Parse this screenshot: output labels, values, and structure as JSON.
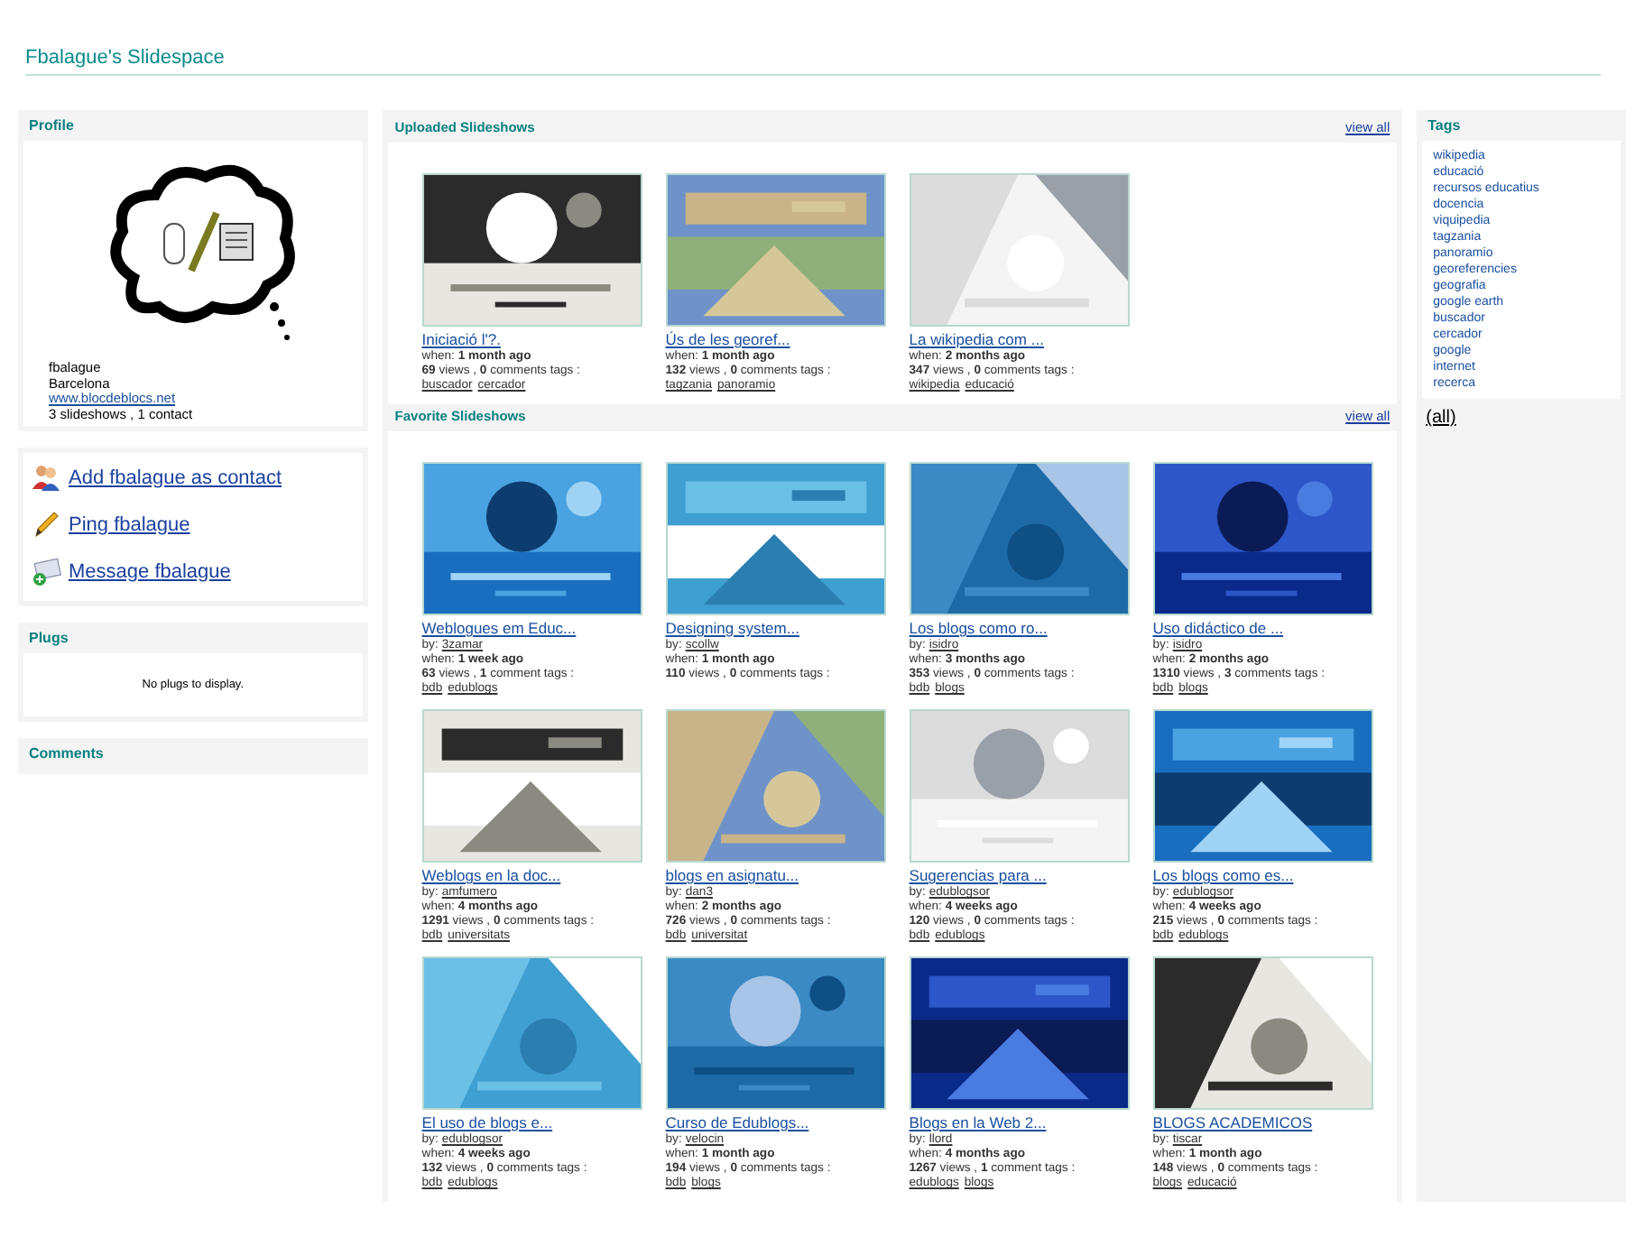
{
  "page_title": "Fbalague's Slidespace",
  "profile": {
    "title": "Profile",
    "name": "fbalague",
    "city": "Barcelona",
    "website": "www.blocdeblocs.net",
    "summary": "3 slideshows , 1 contact"
  },
  "actions": [
    {
      "kind": "contact",
      "label": "Add fbalague as contact"
    },
    {
      "kind": "ping",
      "label": "Ping fbalague"
    },
    {
      "kind": "message",
      "label": "Message fbalague"
    }
  ],
  "plugs": {
    "title": "Plugs",
    "empty": "No plugs to display."
  },
  "comments": {
    "title": "Comments"
  },
  "uploaded": {
    "title": "Uploaded Slideshows",
    "view_all": "view all",
    "items": [
      {
        "title": "Iniciació l'?.",
        "when": "when: **1 month ago**",
        "stats": "**69** views , **0** comments  tags :",
        "tags": [
          "buscador",
          "cercador"
        ]
      },
      {
        "title": "Ús de les georef...",
        "when": "when: **1 month ago**",
        "stats": "**132** views , **0** comments  tags :",
        "tags": [
          "tagzania",
          "panoramio"
        ]
      },
      {
        "title": "La wikipedia com ...",
        "when": "when: **2 months ago**",
        "stats": "**347** views , **0** comments  tags :",
        "tags": [
          "wikipedia",
          "educació"
        ]
      }
    ]
  },
  "favorites": {
    "title": "Favorite Slideshows",
    "view_all": "view all",
    "items": [
      {
        "title": "Weblogues em Educ...",
        "by_label": "by:",
        "by": "3zamar",
        "when": "when: **1 week ago**",
        "stats": "**63** views , **1** comment  tags :",
        "tags": [
          "bdb",
          "edublogs"
        ]
      },
      {
        "title": "Designing system...",
        "by_label": "by:",
        "by": "scollw",
        "when": "when: **1 month ago**",
        "stats": "**110** views , **0** comments  tags :"
      },
      {
        "title": "Los blogs como ro...",
        "by_label": "by:",
        "by": "isidro",
        "when": "when: **3 months ago**",
        "stats": "**353** views , **0** comments  tags :",
        "tags": [
          "bdb",
          "blogs"
        ]
      },
      {
        "title": "Uso didáctico de ...",
        "by_label": "by:",
        "by": "isidro",
        "when": "when: **2 months ago**",
        "stats": "**1310** views , **3** comments  tags :",
        "tags": [
          "bdb",
          "blogs"
        ]
      },
      {
        "title": "Weblogs en la doc...",
        "by_label": "by:",
        "by": "amfumero",
        "when": "when: **4 months ago**",
        "stats": "**1291** views , **0** comments  tags :",
        "tags": [
          "bdb",
          "universitats"
        ]
      },
      {
        "title": "blogs en asignatu...",
        "by_label": "by:",
        "by": "dan3",
        "when": "when: **2 months ago**",
        "stats": "**726** views , **0** comments  tags :",
        "tags": [
          "bdb",
          "universitat"
        ]
      },
      {
        "title": "Sugerencias para ...",
        "by_label": "by:",
        "by": "edublogsor",
        "when": "when: **4 weeks ago**",
        "stats": "**120** views , **0** comments  tags :",
        "tags": [
          "bdb",
          "edublogs"
        ]
      },
      {
        "title": "Los blogs como es...",
        "by_label": "by:",
        "by": "edublogsor",
        "when": "when: **4 weeks ago**",
        "stats": "**215** views , **0** comments  tags :",
        "tags": [
          "bdb",
          "edublogs"
        ]
      },
      {
        "title": "El uso de blogs e...",
        "by_label": "by:",
        "by": "edublogsor",
        "when": "when: **4 weeks ago**",
        "stats": "**132** views , **0** comments  tags :",
        "tags": [
          "bdb",
          "edublogs"
        ]
      },
      {
        "title": "Curso de Edublogs...",
        "by_label": "by:",
        "by": "velocin",
        "when": "when: **1 month ago**",
        "stats": "**194** views , **0** comments  tags :",
        "tags": [
          "bdb",
          "blogs"
        ]
      },
      {
        "title": "Blogs en la Web 2...",
        "by_label": "by:",
        "by": "llord",
        "when": "when: **4 months ago**",
        "stats": "**1267** views , **1** comment  tags :",
        "tags": [
          "edublogs",
          "blogs"
        ]
      },
      {
        "title": "BLOGS ACADEMICOS",
        "by_label": "by:",
        "by": "tiscar",
        "when": "when: **1 month ago**",
        "stats": "**148** views , **0** comments  tags :",
        "tags": [
          "blogs",
          "educació"
        ]
      }
    ]
  },
  "tags": {
    "title": "Tags",
    "items": [
      "wikipedia",
      "educació",
      "recursos educatius",
      "docencia",
      "viquipedia",
      "tagzania",
      "panoramio",
      "georeferencies",
      "geografia",
      "google earth",
      "buscador",
      "cercador",
      "google",
      "internet",
      "recerca"
    ],
    "all": "(all)"
  }
}
